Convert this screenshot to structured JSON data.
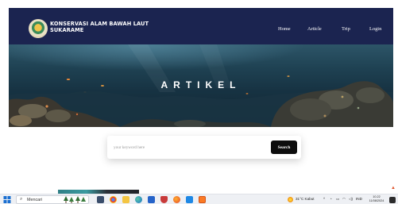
{
  "navbar": {
    "brand_line1": "KONSERVASI ALAM BAWAH LAUT",
    "brand_line2": "SUKARAME",
    "links": [
      "Home",
      "Article",
      "Trip",
      "Login"
    ]
  },
  "hero": {
    "title": "ARTIKEL"
  },
  "search": {
    "placeholder": "your keyword here",
    "button_label": "Search"
  },
  "taskbar": {
    "search_placeholder": "Mencari",
    "weather": "31°C Kabut",
    "language": "IND",
    "time": "10.22",
    "date": "11/08/2024"
  },
  "colors": {
    "navbar_bg": "#1b2450",
    "search_button_bg": "#0d0d0d",
    "taskbar_bg": "#eef0f4"
  },
  "icons": [
    "windows-start-icon",
    "search-icon",
    "trees-icon",
    "task-view-icon",
    "chrome-icon",
    "file-explorer-icon",
    "edge-icon",
    "mail-icon",
    "shield-icon",
    "firefox-icon",
    "vscode-icon",
    "xampp-icon",
    "weather-icon",
    "chevron-up-icon",
    "network-icon",
    "volume-icon",
    "battery-icon",
    "notification-icon"
  ]
}
